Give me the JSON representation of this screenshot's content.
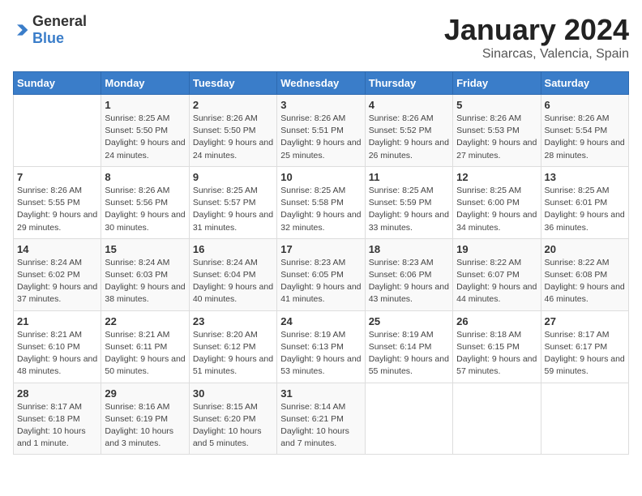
{
  "header": {
    "logo": {
      "general": "General",
      "blue": "Blue"
    },
    "title": "January 2024",
    "subtitle": "Sinarcas, Valencia, Spain"
  },
  "columns": [
    "Sunday",
    "Monday",
    "Tuesday",
    "Wednesday",
    "Thursday",
    "Friday",
    "Saturday"
  ],
  "weeks": [
    {
      "cells": [
        {
          "day": "",
          "content": ""
        },
        {
          "day": "1",
          "content": "Sunrise: 8:25 AM\nSunset: 5:50 PM\nDaylight: 9 hours\nand 24 minutes."
        },
        {
          "day": "2",
          "content": "Sunrise: 8:26 AM\nSunset: 5:50 PM\nDaylight: 9 hours\nand 24 minutes."
        },
        {
          "day": "3",
          "content": "Sunrise: 8:26 AM\nSunset: 5:51 PM\nDaylight: 9 hours\nand 25 minutes."
        },
        {
          "day": "4",
          "content": "Sunrise: 8:26 AM\nSunset: 5:52 PM\nDaylight: 9 hours\nand 26 minutes."
        },
        {
          "day": "5",
          "content": "Sunrise: 8:26 AM\nSunset: 5:53 PM\nDaylight: 9 hours\nand 27 minutes."
        },
        {
          "day": "6",
          "content": "Sunrise: 8:26 AM\nSunset: 5:54 PM\nDaylight: 9 hours\nand 28 minutes."
        }
      ]
    },
    {
      "cells": [
        {
          "day": "7",
          "content": "Sunrise: 8:26 AM\nSunset: 5:55 PM\nDaylight: 9 hours\nand 29 minutes."
        },
        {
          "day": "8",
          "content": "Sunrise: 8:26 AM\nSunset: 5:56 PM\nDaylight: 9 hours\nand 30 minutes."
        },
        {
          "day": "9",
          "content": "Sunrise: 8:25 AM\nSunset: 5:57 PM\nDaylight: 9 hours\nand 31 minutes."
        },
        {
          "day": "10",
          "content": "Sunrise: 8:25 AM\nSunset: 5:58 PM\nDaylight: 9 hours\nand 32 minutes."
        },
        {
          "day": "11",
          "content": "Sunrise: 8:25 AM\nSunset: 5:59 PM\nDaylight: 9 hours\nand 33 minutes."
        },
        {
          "day": "12",
          "content": "Sunrise: 8:25 AM\nSunset: 6:00 PM\nDaylight: 9 hours\nand 34 minutes."
        },
        {
          "day": "13",
          "content": "Sunrise: 8:25 AM\nSunset: 6:01 PM\nDaylight: 9 hours\nand 36 minutes."
        }
      ]
    },
    {
      "cells": [
        {
          "day": "14",
          "content": "Sunrise: 8:24 AM\nSunset: 6:02 PM\nDaylight: 9 hours\nand 37 minutes."
        },
        {
          "day": "15",
          "content": "Sunrise: 8:24 AM\nSunset: 6:03 PM\nDaylight: 9 hours\nand 38 minutes."
        },
        {
          "day": "16",
          "content": "Sunrise: 8:24 AM\nSunset: 6:04 PM\nDaylight: 9 hours\nand 40 minutes."
        },
        {
          "day": "17",
          "content": "Sunrise: 8:23 AM\nSunset: 6:05 PM\nDaylight: 9 hours\nand 41 minutes."
        },
        {
          "day": "18",
          "content": "Sunrise: 8:23 AM\nSunset: 6:06 PM\nDaylight: 9 hours\nand 43 minutes."
        },
        {
          "day": "19",
          "content": "Sunrise: 8:22 AM\nSunset: 6:07 PM\nDaylight: 9 hours\nand 44 minutes."
        },
        {
          "day": "20",
          "content": "Sunrise: 8:22 AM\nSunset: 6:08 PM\nDaylight: 9 hours\nand 46 minutes."
        }
      ]
    },
    {
      "cells": [
        {
          "day": "21",
          "content": "Sunrise: 8:21 AM\nSunset: 6:10 PM\nDaylight: 9 hours\nand 48 minutes."
        },
        {
          "day": "22",
          "content": "Sunrise: 8:21 AM\nSunset: 6:11 PM\nDaylight: 9 hours\nand 50 minutes."
        },
        {
          "day": "23",
          "content": "Sunrise: 8:20 AM\nSunset: 6:12 PM\nDaylight: 9 hours\nand 51 minutes."
        },
        {
          "day": "24",
          "content": "Sunrise: 8:19 AM\nSunset: 6:13 PM\nDaylight: 9 hours\nand 53 minutes."
        },
        {
          "day": "25",
          "content": "Sunrise: 8:19 AM\nSunset: 6:14 PM\nDaylight: 9 hours\nand 55 minutes."
        },
        {
          "day": "26",
          "content": "Sunrise: 8:18 AM\nSunset: 6:15 PM\nDaylight: 9 hours\nand 57 minutes."
        },
        {
          "day": "27",
          "content": "Sunrise: 8:17 AM\nSunset: 6:17 PM\nDaylight: 9 hours\nand 59 minutes."
        }
      ]
    },
    {
      "cells": [
        {
          "day": "28",
          "content": "Sunrise: 8:17 AM\nSunset: 6:18 PM\nDaylight: 10 hours\nand 1 minute."
        },
        {
          "day": "29",
          "content": "Sunrise: 8:16 AM\nSunset: 6:19 PM\nDaylight: 10 hours\nand 3 minutes."
        },
        {
          "day": "30",
          "content": "Sunrise: 8:15 AM\nSunset: 6:20 PM\nDaylight: 10 hours\nand 5 minutes."
        },
        {
          "day": "31",
          "content": "Sunrise: 8:14 AM\nSunset: 6:21 PM\nDaylight: 10 hours\nand 7 minutes."
        },
        {
          "day": "",
          "content": ""
        },
        {
          "day": "",
          "content": ""
        },
        {
          "day": "",
          "content": ""
        }
      ]
    }
  ]
}
